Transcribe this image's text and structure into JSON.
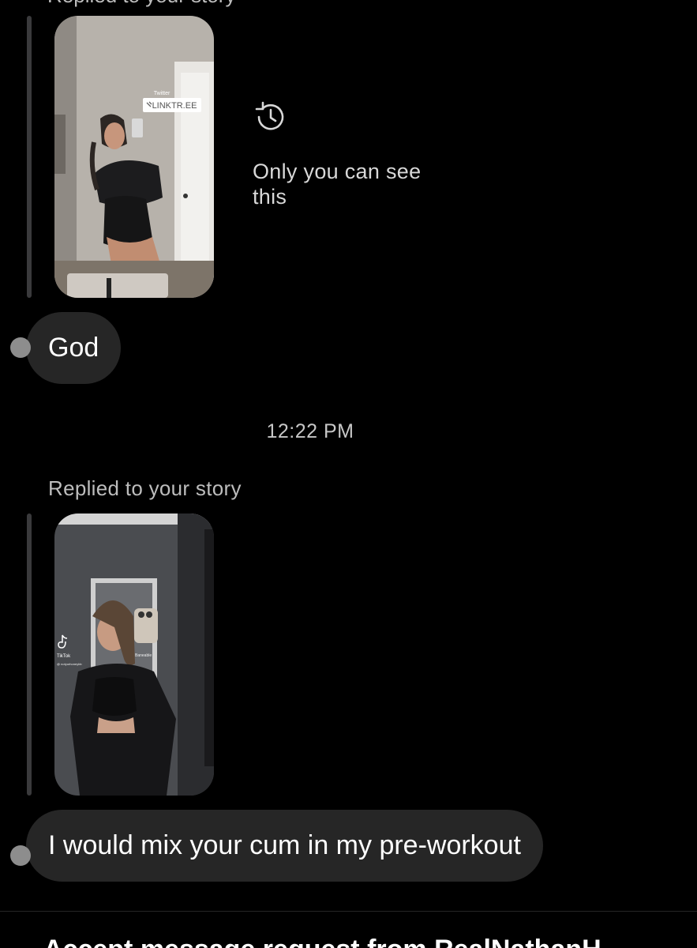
{
  "thread": {
    "top_cutoff_text": "Replied to your story",
    "first_story": {
      "sticker_top": "Twitter",
      "sticker_link": "LINKTR.EE"
    },
    "expired_notice": {
      "icon": "clock-history-icon",
      "text": "Only you can see this"
    },
    "message_1": "God",
    "timestamp": "12:22 PM",
    "replied_label": "Replied to your story",
    "second_story": {
      "watermark_app": "TikTok",
      "watermark_handle": "@ notyurhoneybb",
      "sticker_small": "Baneable"
    },
    "message_2": "I would mix your cum in my pre-workout",
    "bottom_cutoff_text": "Accept message request from RealNathanH"
  },
  "colors": {
    "background": "#000000",
    "bubble": "#262626",
    "secondary_text": "#c7c7c7",
    "quote_bar": "#3a3a3c"
  }
}
